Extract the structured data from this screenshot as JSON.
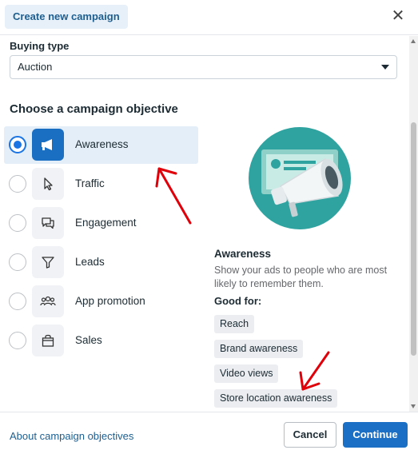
{
  "header": {
    "title": "Create new campaign",
    "close_icon": "close-icon"
  },
  "buying": {
    "label": "Buying type",
    "selected": "Auction"
  },
  "objectives_title": "Choose a campaign objective",
  "objectives": [
    {
      "label": "Awareness",
      "icon": "megaphone-icon",
      "selected": true
    },
    {
      "label": "Traffic",
      "icon": "cursor-icon",
      "selected": false
    },
    {
      "label": "Engagement",
      "icon": "chat-bubbles-icon",
      "selected": false
    },
    {
      "label": "Leads",
      "icon": "funnel-icon",
      "selected": false
    },
    {
      "label": "App promotion",
      "icon": "people-icon",
      "selected": false
    },
    {
      "label": "Sales",
      "icon": "shopping-bag-icon",
      "selected": false
    }
  ],
  "detail": {
    "title": "Awareness",
    "description": "Show your ads to people who are most likely to remember them.",
    "good_for_label": "Good for:",
    "tags": [
      "Reach",
      "Brand awareness",
      "Video views",
      "Store location awareness"
    ]
  },
  "footer": {
    "about_link": "About campaign objectives",
    "cancel": "Cancel",
    "continue": "Continue"
  },
  "colors": {
    "accent": "#1b74e4",
    "annotation": "#e0000a"
  }
}
